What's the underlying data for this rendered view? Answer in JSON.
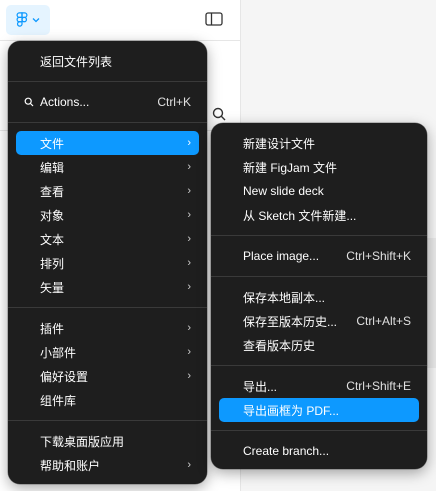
{
  "main_menu": {
    "back_to_files": "返回文件列表",
    "actions": {
      "label": "Actions...",
      "shortcut": "Ctrl+K"
    },
    "group1": [
      "文件",
      "编辑",
      "查看",
      "对象",
      "文本",
      "排列",
      "矢量"
    ],
    "group2": [
      "插件",
      "小部件",
      "偏好设置",
      "组件库"
    ],
    "download_app": "下载桌面版应用",
    "help_account": "帮助和账户"
  },
  "file_menu": {
    "new_design": "新建设计文件",
    "new_figjam": "新建 FigJam 文件",
    "new_slide": "New slide deck",
    "new_from_sketch": "从 Sketch 文件新建...",
    "place_image": {
      "label": "Place image...",
      "shortcut": "Ctrl+Shift+K"
    },
    "save_local": "保存本地副本...",
    "save_version": {
      "label": "保存至版本历史...",
      "shortcut": "Ctrl+Alt+S"
    },
    "view_versions": "查看版本历史",
    "export": {
      "label": "导出...",
      "shortcut": "Ctrl+Shift+E"
    },
    "export_frames_pdf": "导出画框为 PDF...",
    "create_branch": "Create branch..."
  },
  "colors": {
    "accent": "#0d99ff",
    "menu_bg": "#1e1e1e",
    "logo_bg": "#e5f4ff"
  },
  "icons": [
    "figma-logo-icon",
    "chevron-down-icon",
    "panel-toggle-icon",
    "search-icon",
    "chevron-right-icon"
  ]
}
